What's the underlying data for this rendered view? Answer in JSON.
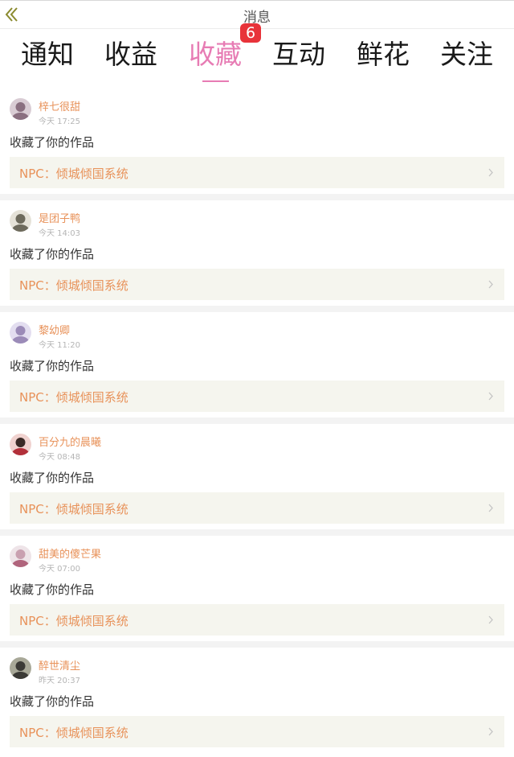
{
  "header": {
    "title": "消息",
    "back_icon": "chevron-double-left-icon"
  },
  "tabs": [
    {
      "label": "通知",
      "active": false
    },
    {
      "label": "收益",
      "active": false
    },
    {
      "label": "收藏",
      "active": true
    },
    {
      "label": "互动",
      "active": false
    },
    {
      "label": "鲜花",
      "active": false
    },
    {
      "label": "关注",
      "active": false
    }
  ],
  "badge": {
    "count": "6",
    "color": "#e8333a"
  },
  "colors": {
    "accent": "#e77cb4",
    "username": "#e8925a",
    "work_bg": "#f5f5ee"
  },
  "messages": [
    {
      "username": "梓七很甜",
      "time": "今天 17:25",
      "action": "收藏了你的作品",
      "work": "NPC：倾城倾国系统",
      "avatar_color": "#8a6f80"
    },
    {
      "username": "是团子鸭",
      "time": "今天 14:03",
      "action": "收藏了你的作品",
      "work": "NPC：倾城倾国系统",
      "avatar_color": "#6d6a5c"
    },
    {
      "username": "黎幼卿",
      "time": "今天 11:20",
      "action": "收藏了你的作品",
      "work": "NPC：倾城倾国系统",
      "avatar_color": "#9b8bb8"
    },
    {
      "username": "百分九的晨曦",
      "time": "今天 08:48",
      "action": "收藏了你的作品",
      "work": "NPC：倾城倾国系统",
      "avatar_color": "#b2303a"
    },
    {
      "username": "甜美的傻芒果",
      "time": "今天 07:00",
      "action": "收藏了你的作品",
      "work": "NPC：倾城倾国系统",
      "avatar_color": "#b0647c"
    },
    {
      "username": "醉世清尘",
      "time": "昨天 20:37",
      "action": "收藏了你的作品",
      "work": "NPC：倾城倾国系统",
      "avatar_color": "#3b3a36"
    }
  ]
}
